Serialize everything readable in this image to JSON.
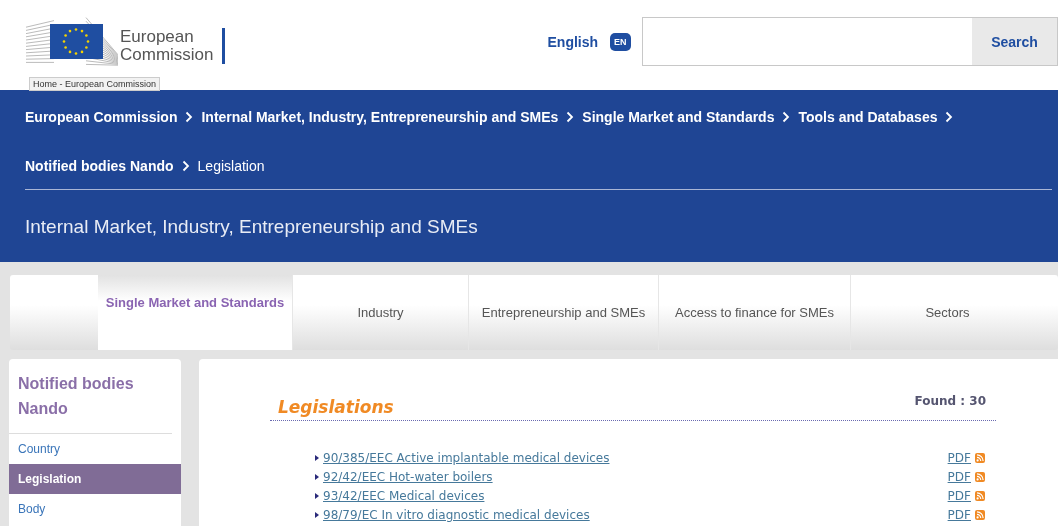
{
  "header": {
    "logo_text": [
      "European",
      "Commission"
    ],
    "tooltip": "Home - European Commission",
    "language": "English",
    "language_code": "EN",
    "search": {
      "button": "Search"
    }
  },
  "breadcrumb": [
    {
      "label": "European Commission",
      "current": false
    },
    {
      "label": "Internal Market, Industry, Entrepreneurship and SMEs",
      "current": false
    },
    {
      "label": "Single Market and Standards",
      "current": false
    },
    {
      "label": "Tools and Databases",
      "current": false
    },
    {
      "label": "Notified bodies Nando",
      "current": false
    },
    {
      "label": "Legislation",
      "current": true
    }
  ],
  "site_title": "Internal Market, Industry, Entrepreneurship and SMEs",
  "tabs": [
    {
      "label": "Single Market and Standards",
      "selected": true
    },
    {
      "label": "Industry",
      "selected": false
    },
    {
      "label": "Entrepreneurship and SMEs",
      "selected": false
    },
    {
      "label": "Access to finance for SMEs",
      "selected": false
    },
    {
      "label": "Sectors",
      "selected": false
    }
  ],
  "sidebar": {
    "title": "Notified bodies Nando",
    "items": [
      {
        "label": "Country",
        "selected": false
      },
      {
        "label": "Legislation",
        "selected": true
      },
      {
        "label": "Body",
        "selected": false
      }
    ]
  },
  "content": {
    "title": "Legislations",
    "found": "Found : 30",
    "rows": [
      {
        "title": "90/385/EEC Active implantable medical devices",
        "pdf": "PDF"
      },
      {
        "title": "92/42/EEC Hot-water boilers",
        "pdf": "PDF"
      },
      {
        "title": "93/42/EEC Medical devices",
        "pdf": "PDF"
      },
      {
        "title": "98/79/EC In vitro diagnostic medical devices",
        "pdf": "PDF"
      }
    ]
  }
}
